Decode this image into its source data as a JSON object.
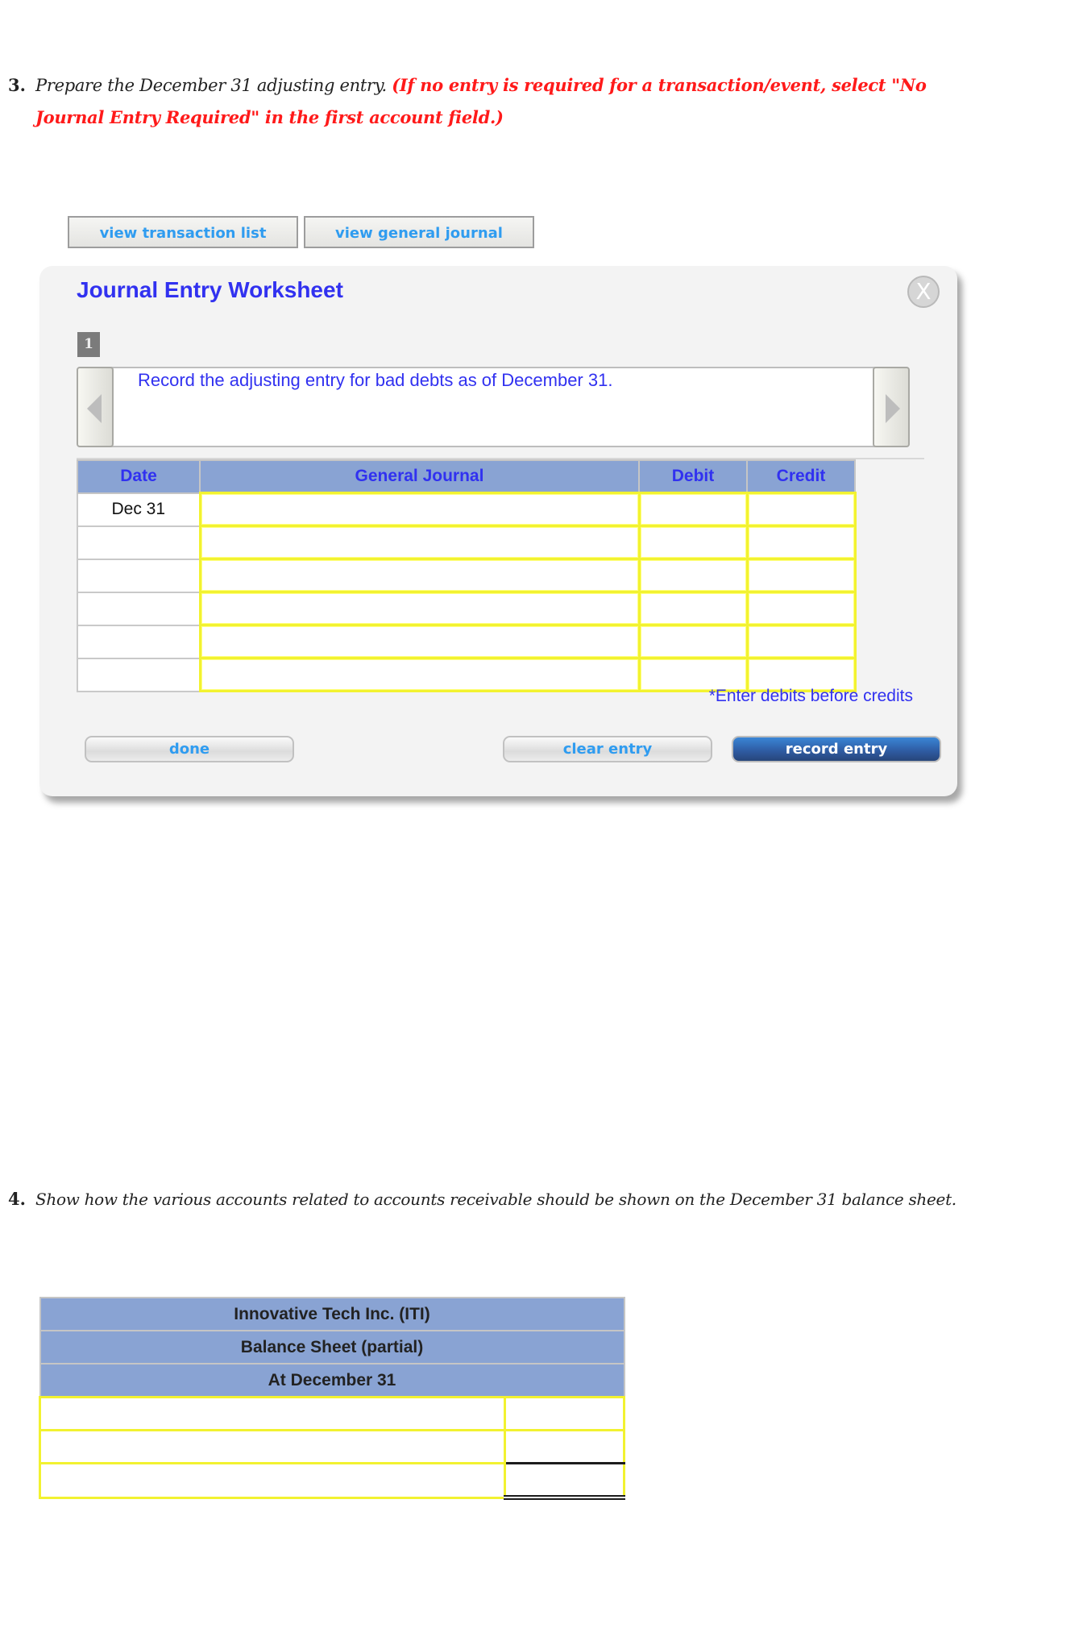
{
  "question3": {
    "number": "3.",
    "prompt": "Prepare the December 31 adjusting entry.",
    "instruction": "(If no entry is required for a transaction/event, select \"No Journal Entry Required\" in the first account field.)"
  },
  "toolbar": {
    "view_transaction_list": "view transaction list",
    "view_general_journal": "view general journal"
  },
  "worksheet": {
    "title": "Journal Entry Worksheet",
    "close_icon": "X",
    "entry_number": "1",
    "instruction": "Record the adjusting entry for bad debts as of December 31.",
    "columns": [
      "Date",
      "General Journal",
      "Debit",
      "Credit"
    ],
    "rows": [
      {
        "date": "Dec 31",
        "account": "",
        "debit": "",
        "credit": ""
      },
      {
        "date": "",
        "account": "",
        "debit": "",
        "credit": ""
      },
      {
        "date": "",
        "account": "",
        "debit": "",
        "credit": ""
      },
      {
        "date": "",
        "account": "",
        "debit": "",
        "credit": ""
      },
      {
        "date": "",
        "account": "",
        "debit": "",
        "credit": ""
      },
      {
        "date": "",
        "account": "",
        "debit": "",
        "credit": ""
      }
    ],
    "note": "*Enter debits before credits",
    "buttons": {
      "done": "done",
      "clear_entry": "clear entry",
      "record_entry": "record entry"
    }
  },
  "question4": {
    "number": "4.",
    "prompt": "Show how the various accounts related to accounts receivable should be shown on the December 31 balance sheet."
  },
  "balance_sheet": {
    "company": "Innovative Tech Inc. (ITI)",
    "statement": "Balance Sheet (partial)",
    "date": "At December 31",
    "rows": [
      {
        "label": "",
        "amount": ""
      },
      {
        "label": "",
        "amount": ""
      },
      {
        "label": "",
        "amount": ""
      }
    ]
  }
}
